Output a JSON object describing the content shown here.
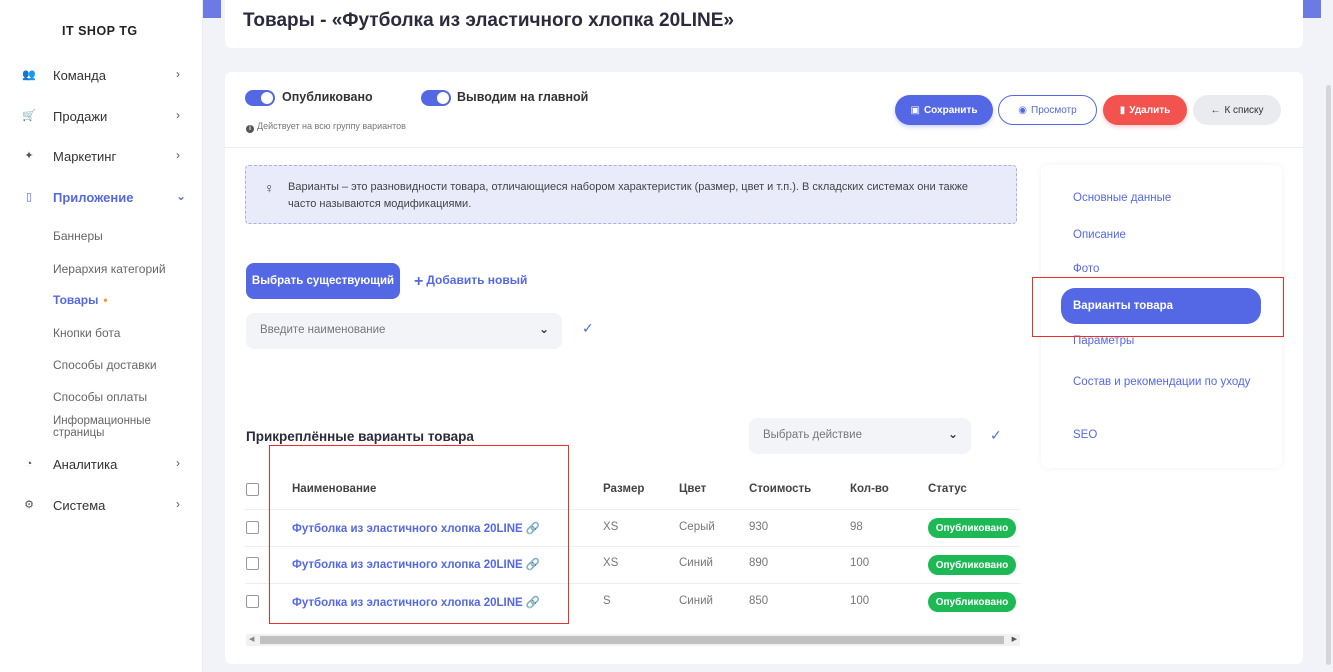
{
  "sidebar": {
    "logo": "IT SHOP TG",
    "items": [
      {
        "label": "Команда",
        "icon": "team-icon"
      },
      {
        "label": "Продажи",
        "icon": "cart-icon"
      },
      {
        "label": "Маркетинг",
        "icon": "marketing-icon"
      },
      {
        "label": "Приложение",
        "icon": "phone-icon",
        "expanded": true
      },
      {
        "label": "Аналитика",
        "icon": "analytics-icon"
      },
      {
        "label": "Система",
        "icon": "settings-icon"
      }
    ],
    "subitems": [
      "Баннеры",
      "Иерархия категорий",
      "Товары",
      "Кнопки бота",
      "Способы доставки",
      "Способы оплаты",
      "Информационные страницы"
    ],
    "active_dot": "•"
  },
  "header": {
    "title": "Товары - «Футболка из эластичного хлопка 20LINE»"
  },
  "toggles": {
    "published": "Опубликовано",
    "main": "Выводим на главной",
    "hint": "Действует на всю группу вариантов"
  },
  "actions": {
    "save": "Сохранить",
    "view": "Просмотр",
    "delete": "Удалить",
    "back": "К списку"
  },
  "info": {
    "text": "Варианты – это разновидности товара, отличающиеся набором характеристик (размер, цвет и т.п.). В складских системах они также часто называются модификациями."
  },
  "variants": {
    "choose_btn": "Выбрать существующий",
    "add_new": "Добавить новый",
    "search_placeholder": "Введите наименование"
  },
  "attached": {
    "title": "Прикреплённые варианты товара",
    "action_placeholder": "Выбрать действие",
    "columns": [
      "Наименование",
      "Размер",
      "Цвет",
      "Стоимость",
      "Кол-во",
      "Статус"
    ],
    "rows": [
      {
        "name": "Футболка из эластичного хлопка 20LINE",
        "size": "XS",
        "color": "Серый",
        "price": "930",
        "qty": "98",
        "status": "Опубликовано"
      },
      {
        "name": "Футболка из эластичного хлопка 20LINE",
        "size": "XS",
        "color": "Синий",
        "price": "890",
        "qty": "100",
        "status": "Опубликовано"
      },
      {
        "name": "Футболка из эластичного хлопка 20LINE",
        "size": "S",
        "color": "Синий",
        "price": "850",
        "qty": "100",
        "status": "Опубликовано"
      }
    ]
  },
  "right_nav": {
    "items": [
      "Основные данные",
      "Описание",
      "Фото",
      "Варианты товара",
      "Параметры",
      "Состав и рекомендации по уходу",
      "SEO"
    ],
    "active": "Варианты товара"
  },
  "colors": {
    "accent": "#5468e6",
    "danger": "#f2534f",
    "success": "#1db954",
    "highlight": "#e8302c"
  }
}
